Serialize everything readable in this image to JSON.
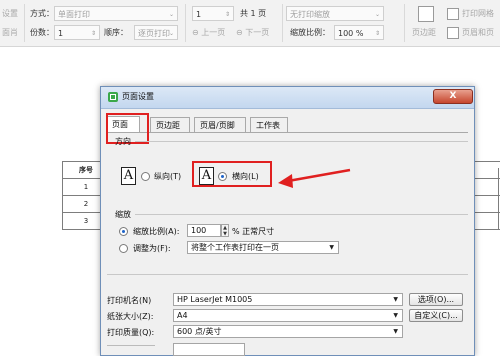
{
  "toolbar": {
    "left_cut_1": "设置",
    "left_cut_2": "面肖",
    "mode_label": "方式：",
    "mode_value": "单面打印",
    "copies_label": "份数：",
    "copies_value": "1",
    "order_label": "顺序：",
    "order_value": "逐页打印",
    "from_value": "1",
    "total_pages": "共 1 页",
    "prev_page": "上一页",
    "next_page": "下一页",
    "no_scale": "无打印缩放",
    "scale_label": "缩放比例：",
    "scale_value": "100 %",
    "margin_label": "页边距",
    "print_grid": "打印网格",
    "header_footer": "页眉和页"
  },
  "sheet": {
    "header": "序号",
    "rows": [
      "1",
      "2",
      "3"
    ]
  },
  "dialog": {
    "title": "页面设置",
    "close": "X",
    "tabs": [
      "页面",
      "页边距",
      "页眉/页脚",
      "工作表"
    ],
    "orientation": {
      "section": "方向",
      "portrait": "纵向(T)",
      "landscape": "横向(L)",
      "selected": "landscape"
    },
    "scaling": {
      "section": "缩放",
      "adjust_label": "缩放比例(A):",
      "adjust_value": "100",
      "adjust_suffix": "% 正常尺寸",
      "fit_label": "调整为(F):",
      "fit_value": "将整个工作表打印在一页"
    },
    "printer_label": "打印机名(N)",
    "printer_value": "HP LaserJet M1005",
    "options_button": "选项(O)...",
    "paper_label": "纸张大小(Z):",
    "paper_value": "A4",
    "custom_button": "自定义(C)...",
    "quality_label": "打印质量(Q):",
    "quality_value": "600 点/英寸"
  },
  "colors": {
    "highlight": "#e02020",
    "title_icon": "#3aa84a",
    "radio_dot": "#1e64c8"
  }
}
